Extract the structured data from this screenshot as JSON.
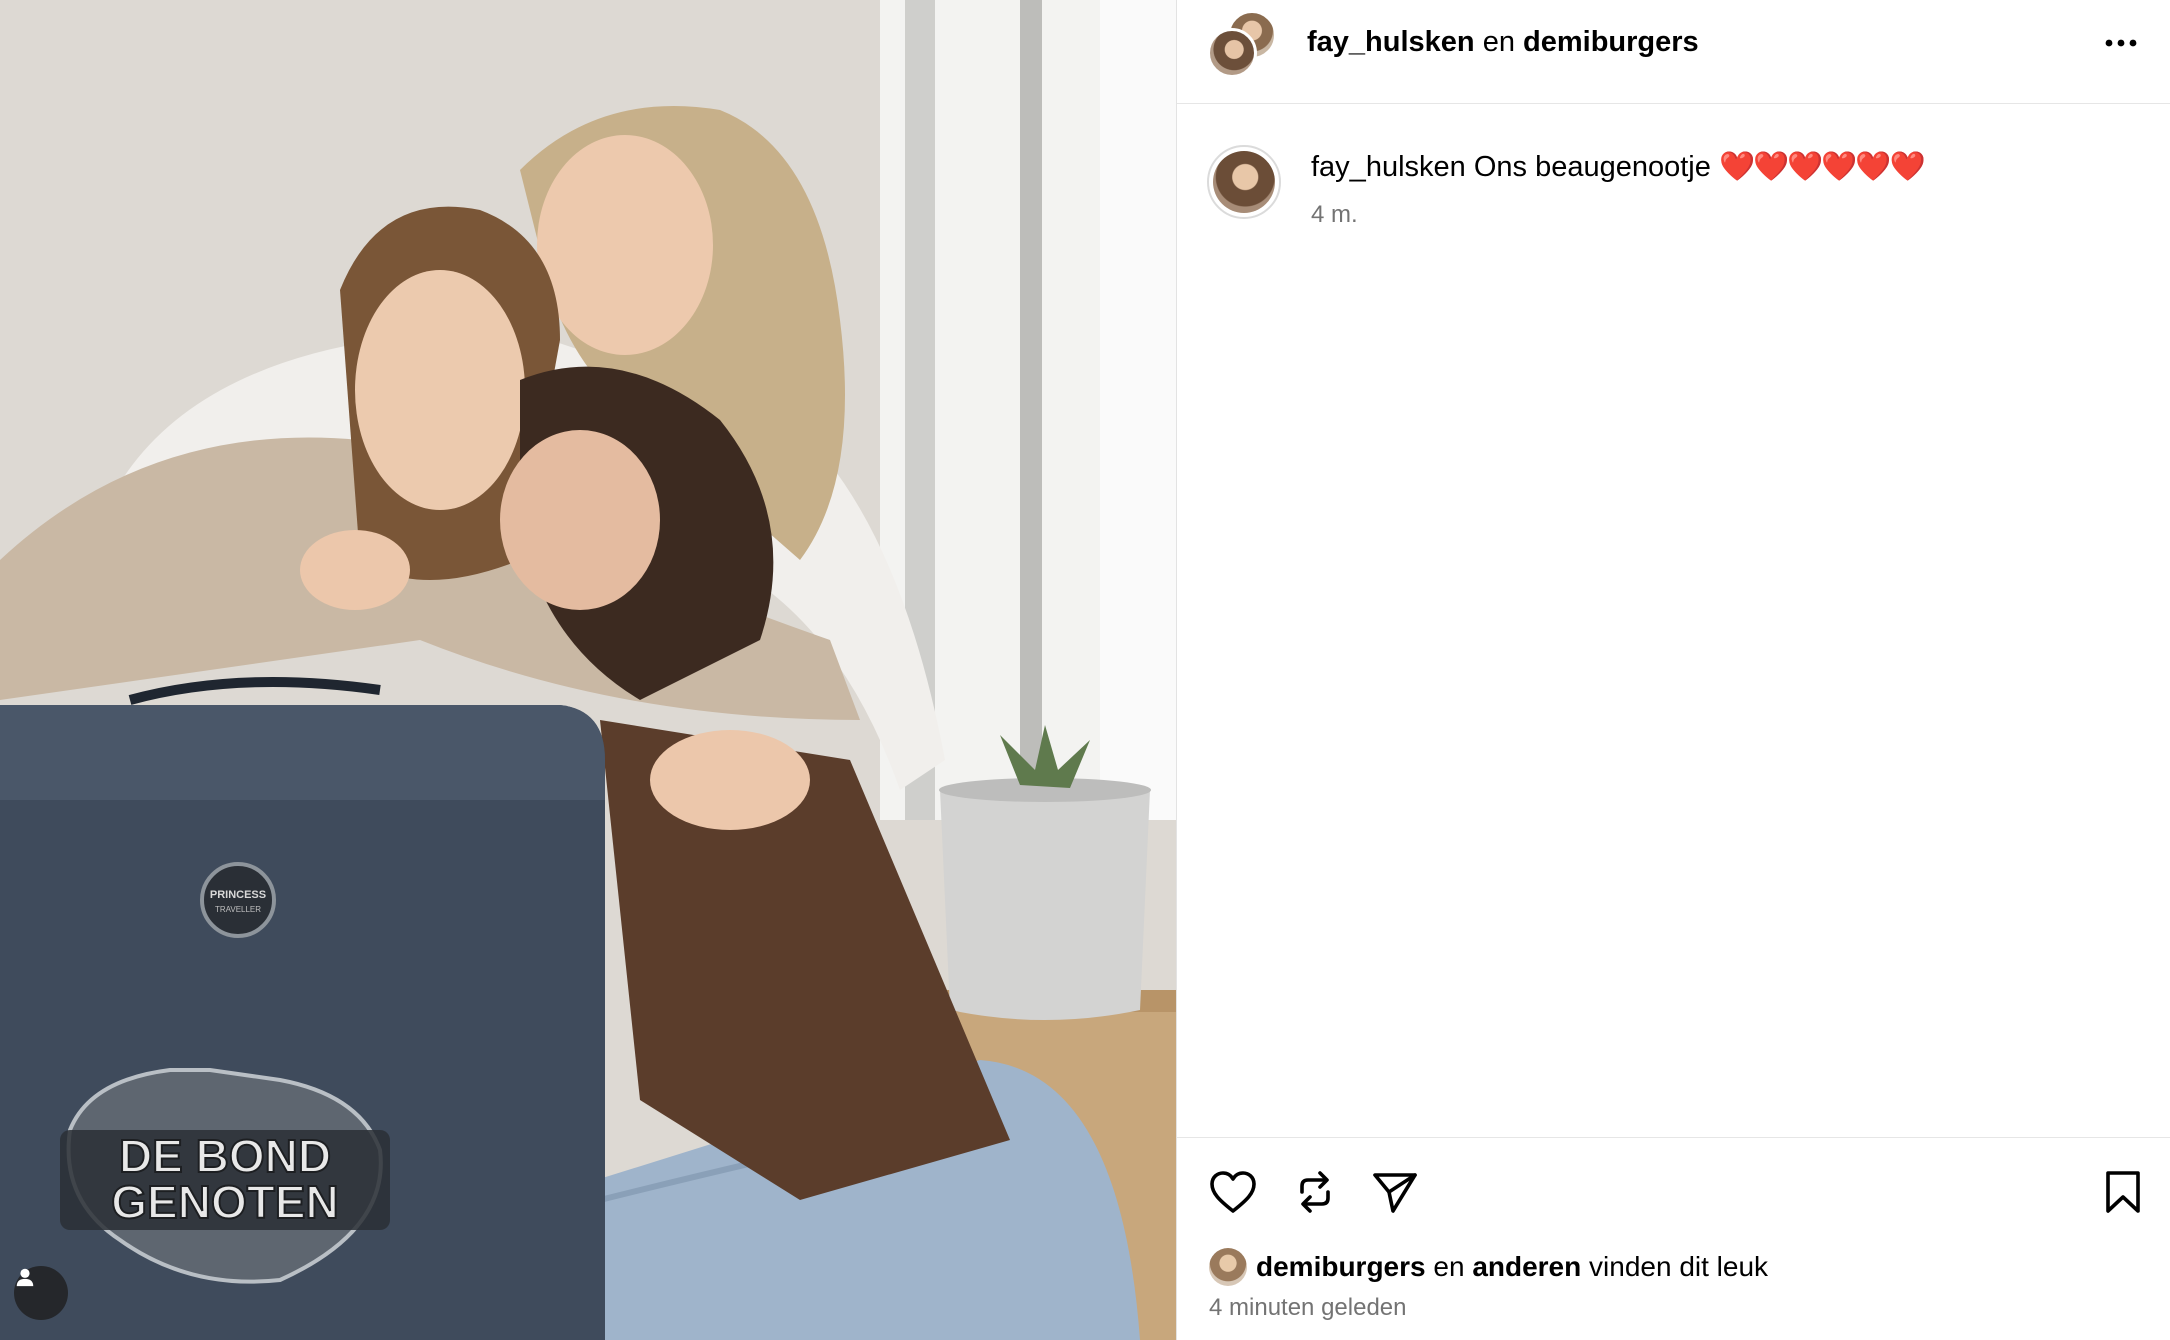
{
  "header": {
    "author": "fay_hulsken",
    "connector": " en ",
    "coauthor": "demiburgers",
    "more_icon": "more-horizontal-icon"
  },
  "caption": {
    "username": "fay_hulsken",
    "text": " Ons beaugenootje ",
    "hearts": "❤️❤️❤️❤️❤️❤️",
    "time": "4 m."
  },
  "photo": {
    "logo_line1": "DE BOND",
    "logo_line2": "GENOTEN",
    "badge_text": "PRINCESS",
    "badge_sub": "TRAVELLER",
    "user_tag_icon": "person-icon"
  },
  "actions": {
    "like_icon": "heart-icon",
    "repost_icon": "repost-icon",
    "share_icon": "send-icon",
    "save_icon": "bookmark-icon"
  },
  "likes": {
    "first_user": "demiburgers",
    "connector": " en ",
    "others": "anderen",
    "suffix": " vinden dit leuk"
  },
  "timestamp": "4 minuten geleden",
  "colors": {
    "hearts": "#e0263f",
    "secondary_text": "#737373",
    "divider": "#e6e6e6"
  }
}
